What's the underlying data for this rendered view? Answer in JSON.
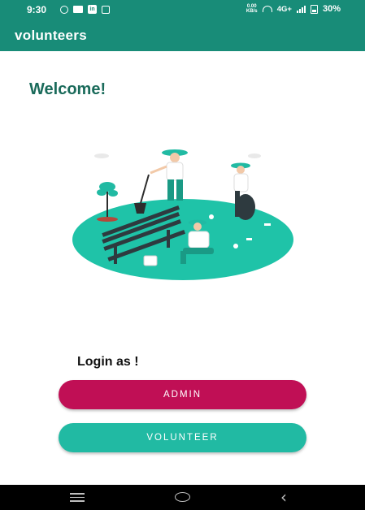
{
  "status_bar": {
    "time": "9:30",
    "speed_value": "0.00",
    "speed_unit": "KB/s",
    "network": "4G+",
    "battery": "30%"
  },
  "app_bar": {
    "title": "volunteers"
  },
  "main": {
    "welcome": "Welcome!",
    "login_prompt": "Login as !",
    "admin_button": "ADMIN",
    "volunteer_button": "VOLUNTEER"
  },
  "colors": {
    "primary": "#188c78",
    "admin_button": "#c00f55",
    "volunteer_button": "#21baa3",
    "welcome_text": "#1b6b5b"
  },
  "icons": [
    "notification-icon",
    "mail-icon",
    "linkedin-icon",
    "sync-icon",
    "hotspot-icon",
    "signal-icon",
    "battery-icon",
    "menu-icon",
    "home-icon",
    "back-icon"
  ]
}
